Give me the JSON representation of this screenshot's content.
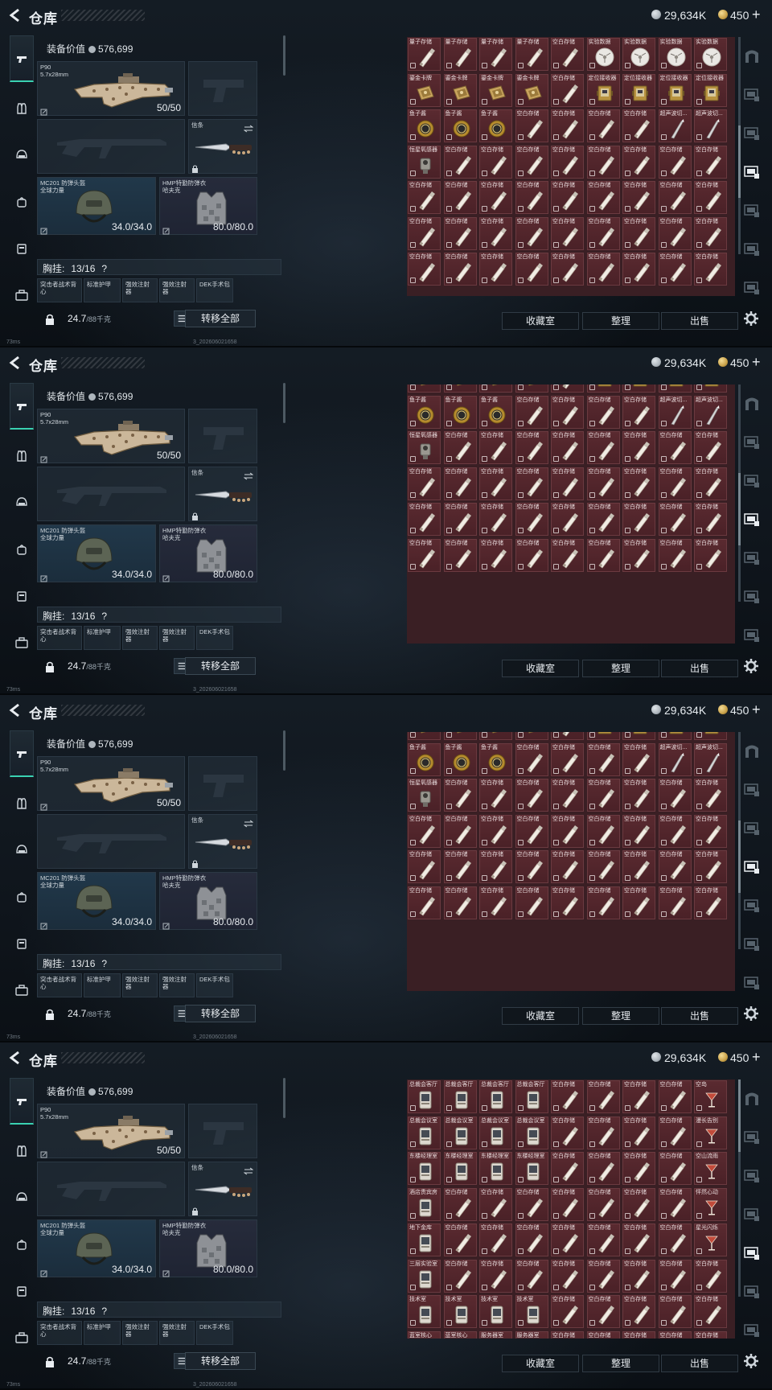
{
  "top": {
    "title": "仓库",
    "silver": "29,634K",
    "gold": "450",
    "plus": "+"
  },
  "loadout": {
    "equip_value_label": "装备价值",
    "equip_value": "576,699",
    "primary": {
      "name": "P90",
      "caliber": "5.7x28mm",
      "ammo": "50/50"
    },
    "melee_label": "信条",
    "helmet": {
      "name": "MC201 防弹头盔",
      "brand": "全球力量",
      "dur": "34.0/34.0"
    },
    "armor": {
      "name": "HMP特勤防弹衣",
      "brand": "哈夫克",
      "dur": "80.0/80.0"
    },
    "chest_label": "胸挂:",
    "chest_count": "13/16",
    "chest_help": "?",
    "mini_slots": [
      "突击者战术背心",
      "标准护甲",
      "强效注射器",
      "强效注射器",
      "DEK手术包"
    ],
    "weight": "24.7",
    "weight_max": "/88千克",
    "transfer_all": "转移全部"
  },
  "storage": {
    "btn_collection": "收藏室",
    "btn_sort": "整理",
    "btn_sell": "出售"
  },
  "status": {
    "ping": "73ms",
    "build": "3_202606021658"
  },
  "frames": [
    {
      "rows": [
        [
          "量子存储",
          "量子存储",
          "量子存储",
          "量子存储",
          "空白存储",
          "实验数据",
          "实验数据",
          "实验数据",
          "实验数据"
        ],
        [
          "鎏金卡牌",
          "鎏金卡牌",
          "鎏金卡牌",
          "鎏金卡牌",
          "空白存储",
          "定位接收器",
          "定位接收器",
          "定位接收器",
          "定位接收器"
        ],
        [
          "鱼子酱",
          "鱼子酱",
          "鱼子酱",
          "空白存储",
          "空白存储",
          "空白存储",
          "空白存储",
          "超声波切...",
          "超声波切..."
        ],
        [
          "恒星氧感器",
          "空白存储",
          "空白存储",
          "空白存储",
          "空白存储",
          "空白存储",
          "空白存储",
          "空白存储",
          "空白存储"
        ],
        [
          "空白存储",
          "空白存储",
          "空白存储",
          "空白存储",
          "空白存储",
          "空白存储",
          "空白存储",
          "空白存储",
          "空白存储"
        ],
        [
          "空白存储",
          "空白存储",
          "空白存储",
          "空白存储",
          "空白存储",
          "空白存储",
          "空白存储",
          "空白存储",
          "空白存储"
        ],
        [
          "空白存储",
          "空白存储",
          "空白存储",
          "空白存储",
          "空白存储",
          "空白存储",
          "空白存储",
          "空白存储",
          "空白存储"
        ]
      ]
    },
    {
      "rows": [
        [
          "鎏金卡牌",
          "鎏金卡牌",
          "鎏金卡牌",
          "鎏金卡牌",
          "空白存储",
          "定位接收器",
          "定位接收器",
          "定位接收器",
          "定位接收器"
        ],
        [
          "鱼子酱",
          "鱼子酱",
          "鱼子酱",
          "空白存储",
          "空白存储",
          "空白存储",
          "空白存储",
          "超声波切...",
          "超声波切..."
        ],
        [
          "恒星氧感器",
          "空白存储",
          "空白存储",
          "空白存储",
          "空白存储",
          "空白存储",
          "空白存储",
          "空白存储",
          "空白存储"
        ],
        [
          "空白存储",
          "空白存储",
          "空白存储",
          "空白存储",
          "空白存储",
          "空白存储",
          "空白存储",
          "空白存储",
          "空白存储"
        ],
        [
          "空白存储",
          "空白存储",
          "空白存储",
          "空白存储",
          "空白存储",
          "空白存储",
          "空白存储",
          "空白存储",
          "空白存储"
        ],
        [
          "空白存储",
          "空白存储",
          "空白存储",
          "空白存储",
          "空白存储",
          "空白存储",
          "空白存储",
          "空白存储",
          "空白存储"
        ]
      ]
    },
    {
      "rows": [
        [
          "鎏金卡牌",
          "鎏金卡牌",
          "鎏金卡牌",
          "鎏金卡牌",
          "空白存储",
          "定位接收器",
          "定位接收器",
          "定位接收器",
          "定位接收器"
        ],
        [
          "鱼子酱",
          "鱼子酱",
          "鱼子酱",
          "空白存储",
          "空白存储",
          "空白存储",
          "空白存储",
          "超声波切...",
          "超声波切..."
        ],
        [
          "恒星氧感器",
          "空白存储",
          "空白存储",
          "空白存储",
          "空白存储",
          "空白存储",
          "空白存储",
          "空白存储",
          "空白存储"
        ],
        [
          "空白存储",
          "空白存储",
          "空白存储",
          "空白存储",
          "空白存储",
          "空白存储",
          "空白存储",
          "空白存储",
          "空白存储"
        ],
        [
          "空白存储",
          "空白存储",
          "空白存储",
          "空白存储",
          "空白存储",
          "空白存储",
          "空白存储",
          "空白存储",
          "空白存储"
        ],
        [
          "空白存储",
          "空白存储",
          "空白存储",
          "空白存储",
          "空白存储",
          "空白存储",
          "空白存储",
          "空白存储",
          "空白存储"
        ]
      ]
    },
    {
      "rows": [
        [
          "总裁会客厅",
          "总裁会客厅",
          "总裁会客厅",
          "总裁会客厅",
          "空白存储",
          "空白存储",
          "空白存储",
          "空白存储",
          "空岛"
        ],
        [
          "总裁会议室",
          "总裁会议室",
          "总裁会议室",
          "总裁会议室",
          "空白存储",
          "空白存储",
          "空白存储",
          "空白存储",
          "漫长告别"
        ],
        [
          "东楼经理室",
          "东楼经理室",
          "东楼经理室",
          "东楼经理室",
          "空白存储",
          "空白存储",
          "空白存储",
          "空白存储",
          "空山流雨"
        ],
        [
          "酒店贵宾房",
          "空白存储",
          "空白存储",
          "空白存储",
          "空白存储",
          "空白存储",
          "空白存储",
          "空白存储",
          "怦然心动"
        ],
        [
          "地下金库",
          "空白存储",
          "空白存储",
          "空白存储",
          "空白存储",
          "空白存储",
          "空白存储",
          "空白存储",
          "星光闪烁"
        ],
        [
          "三层实验室",
          "空白存储",
          "空白存储",
          "空白存储",
          "空白存储",
          "空白存储",
          "空白存储",
          "空白存储",
          "空白存储"
        ],
        [
          "技术室",
          "技术室",
          "技术室",
          "技术室",
          "空白存储",
          "空白存储",
          "空白存储",
          "空白存储",
          "空白存储"
        ],
        [
          "蓝室核心",
          "蓝室核心",
          "服务器室",
          "服务器室",
          "空白存储",
          "空白存储",
          "空白存储",
          "空白存储",
          "空白存储"
        ]
      ]
    }
  ],
  "icons": {
    "back": "back-arrow-icon",
    "weapon": "pistol-icon",
    "rig": "vest-icon",
    "helmet": "helmet-icon",
    "bag": "backpack-icon",
    "pouch": "pouch-icon",
    "case": "briefcase-icon",
    "gear": "gear-icon"
  },
  "colors": {
    "accent": "#3ad1b1",
    "cell_bg": "#4f252b",
    "silver_coin": "#aeb6bd",
    "gold_coin": "#c9a24a"
  }
}
